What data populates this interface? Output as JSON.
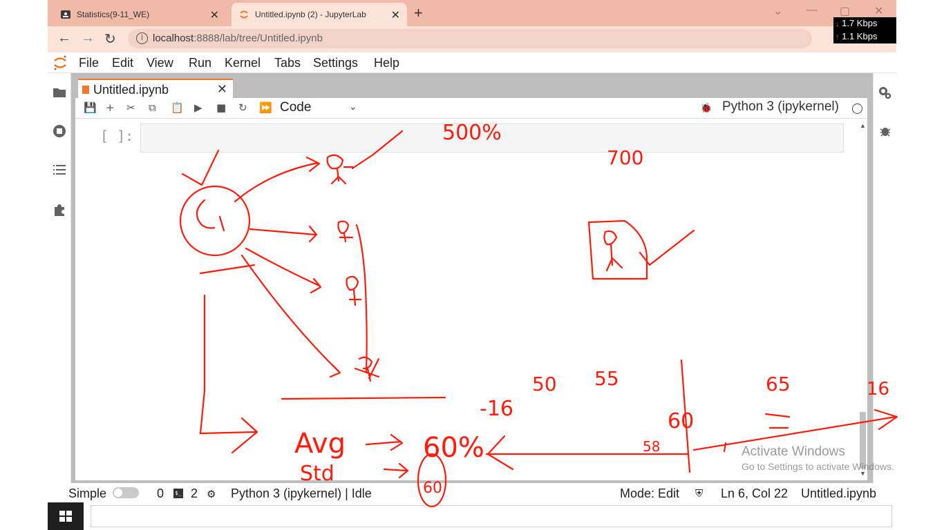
{
  "browser": {
    "tabs": [
      {
        "title": "Statistics(9-11_WE)",
        "active": false
      },
      {
        "title": "Untitled.ipynb (2) - JupyterLab",
        "active": true
      }
    ],
    "url_host": "localhost",
    "url_rest": ":8888/lab/tree/Untitled.ipynb",
    "netspeed": {
      "down": "1.7 Kbps",
      "up": "1.1 Kbps"
    }
  },
  "jupyter": {
    "menu": [
      "File",
      "Edit",
      "View",
      "Run",
      "Kernel",
      "Tabs",
      "Settings",
      "Help"
    ],
    "doc_tab": "Untitled.ipynb",
    "cell_type": "Code",
    "kernel_name": "Python 3 (ipykernel)",
    "cell_prompt": "[ ]:",
    "statusbar": {
      "simple_label": "Simple",
      "terminals": "0",
      "kernels": "2",
      "kernel_status": "Python 3 (ipykernel) | Idle",
      "mode": "Mode: Edit",
      "position": "Ln 6, Col 22",
      "filename": "Untitled.ipynb"
    }
  },
  "watermark": {
    "title": "Activate Windows",
    "subtitle": "Go to Settings to activate Windows."
  },
  "annotations": {
    "top_pct": "500%",
    "top_number": "700",
    "avg_word": "Avg",
    "avg_pct": "60%",
    "std_word": "Std",
    "circled_value": "60",
    "minus_value": "-16",
    "n50": "50",
    "n55": "55",
    "n65": "65",
    "n58": "58",
    "n60": "60",
    "n16": "16"
  },
  "colors": {
    "accent": "#f37726",
    "ink": "#ff1a0a",
    "tabstrip": "#f1b9a8"
  }
}
